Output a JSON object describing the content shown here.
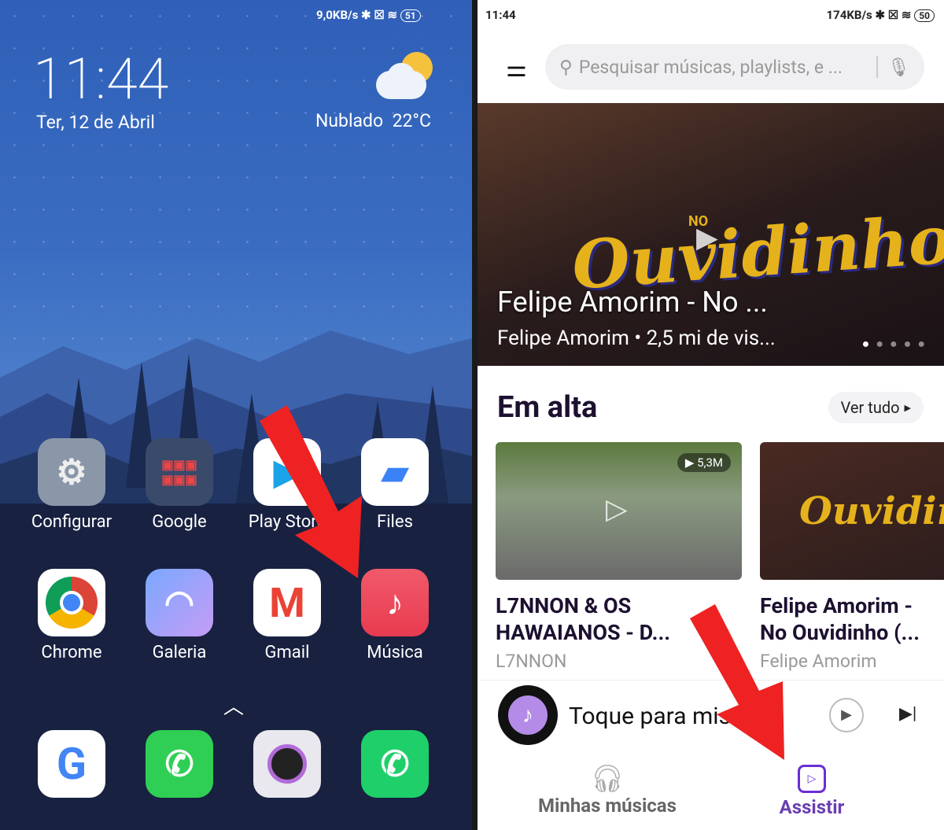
{
  "left": {
    "status": {
      "speed": "9,0KB/s",
      "battery": "51"
    },
    "clock": "11:44",
    "date": "Ter, 12 de Abril",
    "weather": {
      "condition": "Nublado",
      "temp": "22°C",
      "icon": "partly-cloudy-icon"
    },
    "apps_row1": [
      {
        "label": "Configurar",
        "icon": "settings-icon"
      },
      {
        "label": "Google",
        "icon": "google-folder-icon"
      },
      {
        "label": "Play Store",
        "icon": "play-store-icon"
      },
      {
        "label": "Files",
        "icon": "files-icon"
      }
    ],
    "apps_row2": [
      {
        "label": "Chrome",
        "icon": "chrome-icon"
      },
      {
        "label": "Galeria",
        "icon": "gallery-icon"
      },
      {
        "label": "Gmail",
        "icon": "gmail-icon"
      },
      {
        "label": "Música",
        "icon": "music-icon"
      }
    ],
    "dock": [
      {
        "icon": "google-icon"
      },
      {
        "icon": "whatsapp-icon"
      },
      {
        "icon": "camera-icon"
      },
      {
        "icon": "phone-icon"
      }
    ]
  },
  "right": {
    "status": {
      "time": "11:44",
      "speed": "174KB/s",
      "battery": "50"
    },
    "search_placeholder": "Pesquisar músicas, playlists, e ...",
    "banner": {
      "title": "Felipe Amorim - No ...",
      "subtitle": "Felipe Amorim • 2,5 mi de vis...",
      "art_text": "Ouvidinho",
      "art_small": "NO",
      "dots": 5,
      "active_dot": 0
    },
    "section_title": "Em alta",
    "see_all": "Ver tudo",
    "videos": [
      {
        "title": "L7NNON & OS HAWAIANOS  - D...",
        "artist": "L7NNON",
        "views": "5,3M"
      },
      {
        "title": "Felipe Amorim - No Ouvidinho (...",
        "artist": "Felipe Amorim",
        "art_text": "Ouvidinh"
      }
    ],
    "player": {
      "text": "Toque para misturar"
    },
    "nav": [
      {
        "label": "Minhas músicas",
        "icon": "headphones-icon"
      },
      {
        "label": "Assistir",
        "icon": "video-play-icon",
        "active": true
      }
    ],
    "accent": "#6a2fd6"
  },
  "annotation_color": "#ee2222"
}
